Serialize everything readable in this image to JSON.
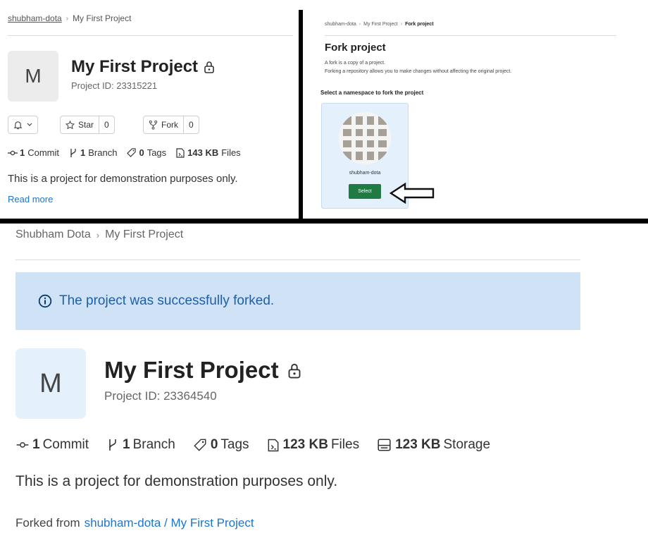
{
  "panel_top_left": {
    "breadcrumb": [
      "shubham-dota",
      "My First Project"
    ],
    "avatar_letter": "M",
    "title": "My First Project",
    "project_id": "Project ID: 23315221",
    "star": {
      "label": "Star",
      "count": "0"
    },
    "fork": {
      "label": "Fork",
      "count": "0"
    },
    "stats": [
      {
        "value": "1",
        "label": "Commit"
      },
      {
        "value": "1",
        "label": "Branch"
      },
      {
        "value": "0",
        "label": "Tags"
      },
      {
        "value": "143 KB",
        "label": "Files"
      }
    ],
    "description": "This is a project for demonstration purposes only.",
    "read_more": "Read more"
  },
  "panel_top_right": {
    "breadcrumb": [
      "shubham-dota",
      "My First Project",
      "Fork project"
    ],
    "title": "Fork project",
    "desc_line1": "A fork is a copy of a project.",
    "desc_line2": "Forking a repository allows you to make changes without affecting the original project.",
    "select_namespace": "Select a namespace to fork the project",
    "namespace_name": "shubham-dota",
    "select_button": "Select"
  },
  "panel_bottom": {
    "breadcrumb": [
      "Shubham Dota",
      "My First Project"
    ],
    "alert_text": "The project was successfully forked.",
    "avatar_letter": "M",
    "title": "My First Project",
    "project_id": "Project ID: 23364540",
    "stats": [
      {
        "value": "1",
        "label": "Commit"
      },
      {
        "value": "1",
        "label": "Branch"
      },
      {
        "value": "0",
        "label": "Tags"
      },
      {
        "value": "123 KB",
        "label": "Files"
      },
      {
        "value": "123 KB",
        "label": "Storage"
      }
    ],
    "description": "This is a project for demonstration purposes only.",
    "forked_from_prefix": "Forked from",
    "forked_from_link": "shubham-dota / My First Project"
  },
  "colors": {
    "link": "#1f75cb",
    "alert_bg": "#cfe2f6",
    "select_green": "#1f7a43",
    "avatar_blue": "#e4f0fc"
  }
}
